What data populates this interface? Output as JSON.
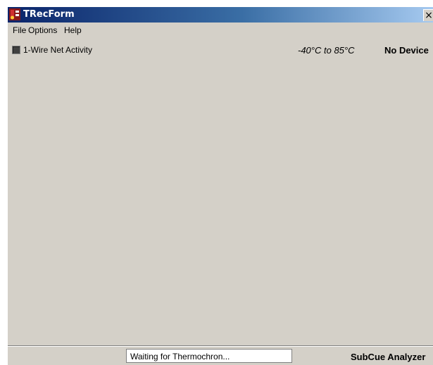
{
  "window": {
    "title": "TRecForm",
    "close_glyph": "×"
  },
  "menu": {
    "items": [
      {
        "label": "File"
      },
      {
        "label": "Options"
      },
      {
        "label": "Help"
      }
    ]
  },
  "activity": {
    "label": "1-Wire Net Activity",
    "temp_range": "-40°C to 85°C",
    "device_status": "No Device"
  },
  "status": {
    "message": "Waiting for Thermochron...",
    "app_name": "SubCue Analyzer"
  },
  "icons": {
    "app": "thermometer-app-icon",
    "led": "activity-led-icon",
    "close": "close-icon"
  },
  "colors": {
    "titlebar_start": "#0a246a",
    "titlebar_end": "#a6caf0",
    "window_face": "#d4d0c8"
  }
}
